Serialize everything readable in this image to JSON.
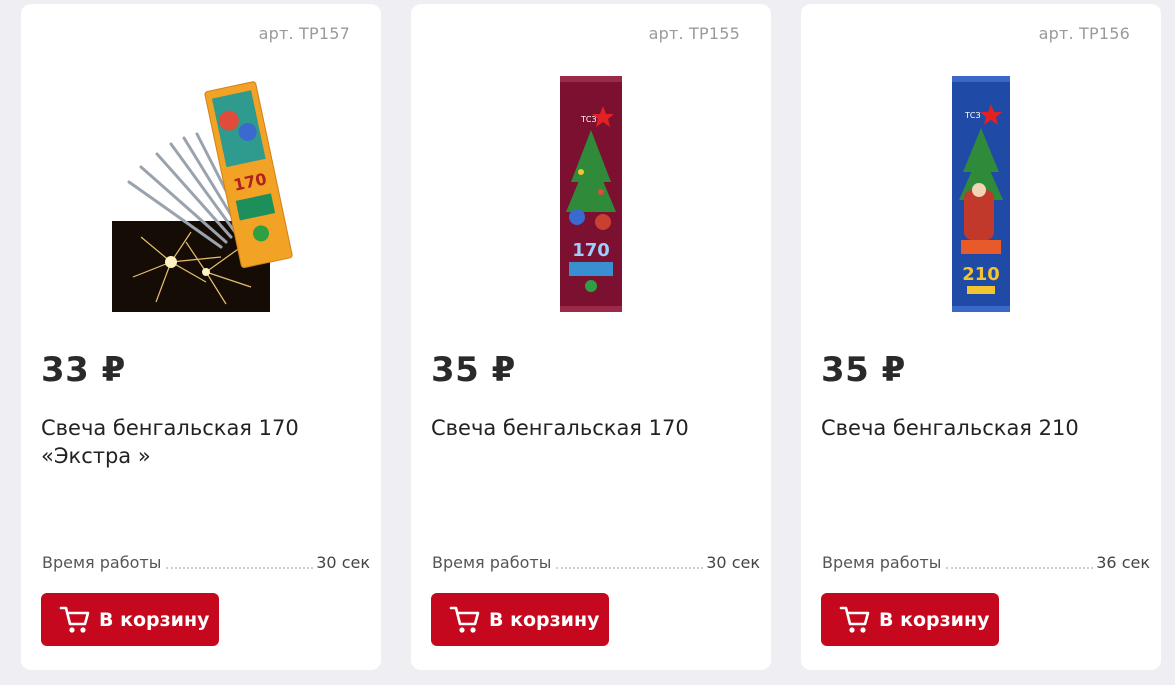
{
  "products": [
    {
      "sku": "арт. ТР157",
      "image_icon": "sparklers-pack-image",
      "price": "33 ₽",
      "title": "Свеча бенгальская 170 «Экстра »",
      "spec_label": "Время работы",
      "spec_value": "30 сек",
      "button_label": "В корзину"
    },
    {
      "sku": "арт. ТР155",
      "image_icon": "sparkler-pack-image",
      "price": "35 ₽",
      "title": "Свеча бенгальская 170",
      "spec_label": "Время работы",
      "spec_value": "30 сек",
      "button_label": "В корзину"
    },
    {
      "sku": "арт. ТР156",
      "image_icon": "sparkler-pack-image",
      "price": "35 ₽",
      "title": "Свеча бенгальская 210",
      "spec_label": "Время работы",
      "spec_value": "36 сек",
      "button_label": "В корзину"
    }
  ],
  "colors": {
    "accent": "#c5081d",
    "page_bg": "#efeff3",
    "card_bg": "#ffffff",
    "pack1": "#f2a224",
    "pack2": "#7b1030",
    "pack3": "#1f4aa6"
  },
  "icons": {
    "cart": "cart-icon"
  }
}
